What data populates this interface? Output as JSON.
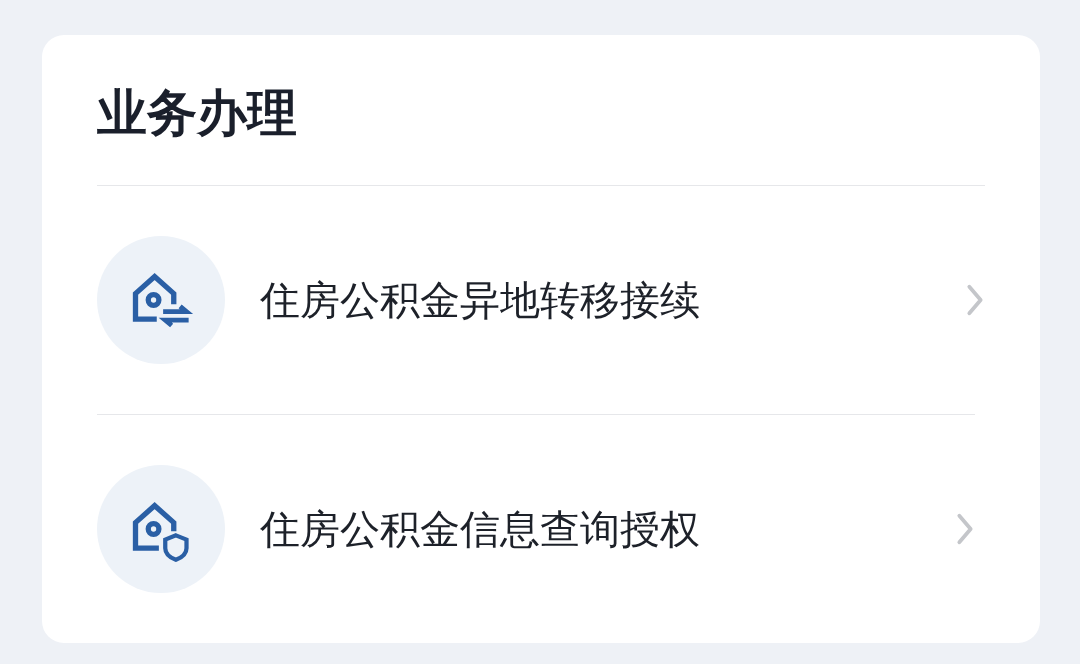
{
  "card": {
    "title": "业务办理",
    "items": [
      {
        "label": "住房公积金异地转移接续",
        "kind": "transfer"
      },
      {
        "label": "住房公积金信息查询授权",
        "kind": "shield"
      }
    ]
  }
}
